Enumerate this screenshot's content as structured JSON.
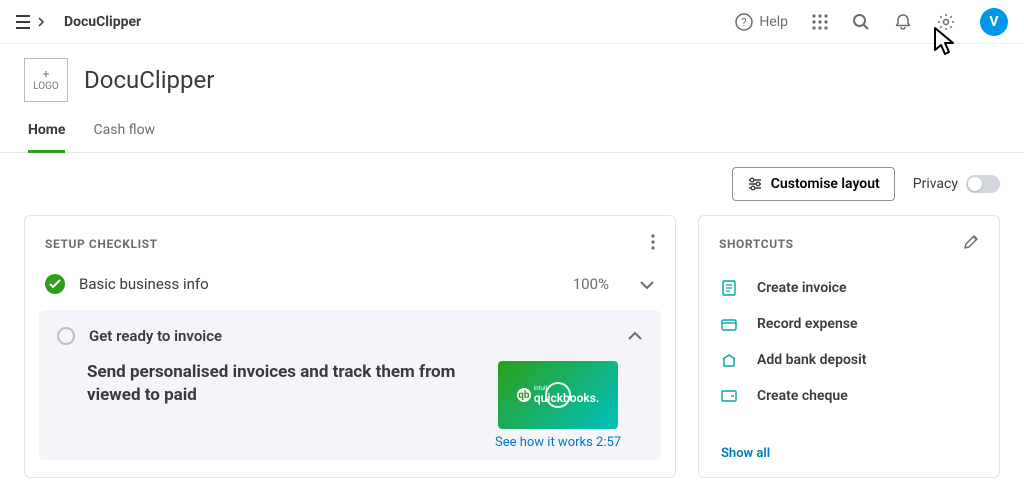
{
  "brand": "DocuClipper",
  "topbar": {
    "help": "Help",
    "avatar_initial": "V"
  },
  "logo_box": {
    "plus": "+",
    "text": "LOGO"
  },
  "company_name": "DocuClipper",
  "tabs": [
    {
      "label": "Home",
      "active": true
    },
    {
      "label": "Cash flow",
      "active": false
    }
  ],
  "toolbar": {
    "customise": "Customise layout",
    "privacy": "Privacy"
  },
  "setup": {
    "title": "SETUP CHECKLIST",
    "items": [
      {
        "label": "Basic business info",
        "percent": "100%",
        "done": true
      },
      {
        "label": "Get ready to invoice",
        "done": false
      }
    ],
    "promo_text": "Send personalised invoices and track them from viewed to paid",
    "video_label": "quickbooks.",
    "video_intuit": "intuit",
    "video_link": "See how it works 2:57"
  },
  "shortcuts": {
    "title": "SHORTCUTS",
    "items": [
      {
        "label": "Create invoice"
      },
      {
        "label": "Record expense"
      },
      {
        "label": "Add bank deposit"
      },
      {
        "label": "Create cheque"
      }
    ],
    "show_all": "Show all"
  }
}
